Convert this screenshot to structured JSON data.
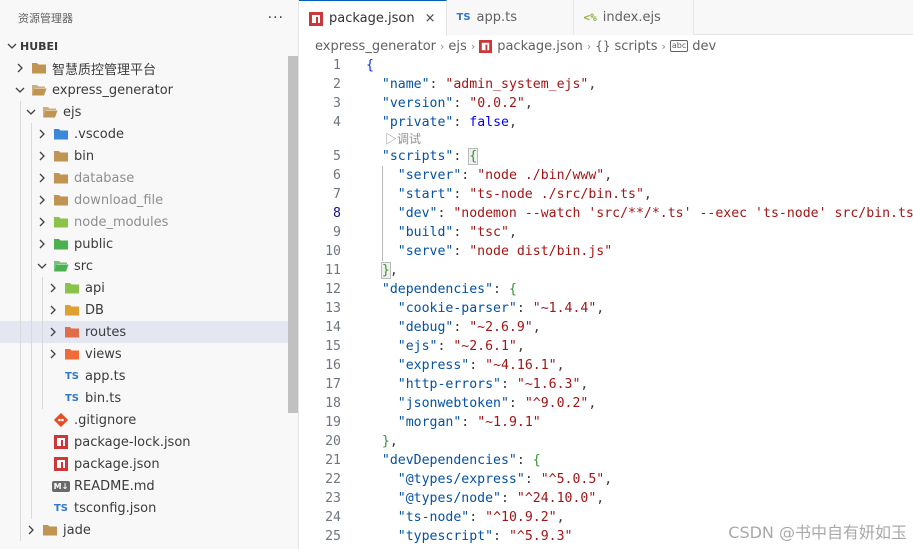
{
  "sidebar": {
    "title": "资源管理器",
    "more": "···",
    "section": "HUBEI",
    "items": [
      {
        "label": "智慧质控管理平台",
        "depth": 1,
        "kind": "folder",
        "open": false,
        "color": "#c09553"
      },
      {
        "label": "express_generator",
        "depth": 1,
        "kind": "folder",
        "open": true,
        "color": "#c09553"
      },
      {
        "label": "ejs",
        "depth": 2,
        "kind": "folder",
        "open": true,
        "color": "#c09553"
      },
      {
        "label": ".vscode",
        "depth": 3,
        "kind": "folder",
        "open": false,
        "color": "#3b88d8"
      },
      {
        "label": "bin",
        "depth": 3,
        "kind": "folder",
        "open": false,
        "color": "#c09553"
      },
      {
        "label": "database",
        "depth": 3,
        "kind": "folder",
        "open": false,
        "color": "#c09553",
        "dim": true
      },
      {
        "label": "download_file",
        "depth": 3,
        "kind": "folder",
        "open": false,
        "color": "#c09553",
        "dim": true
      },
      {
        "label": "node_modules",
        "depth": 3,
        "kind": "folder",
        "open": false,
        "color": "#8bc34a",
        "dim": true
      },
      {
        "label": "public",
        "depth": 3,
        "kind": "folder",
        "open": false,
        "color": "#4caf50"
      },
      {
        "label": "src",
        "depth": 3,
        "kind": "folder",
        "open": true,
        "color": "#4caf50"
      },
      {
        "label": "api",
        "depth": 4,
        "kind": "folder",
        "open": false,
        "color": "#8bc34a"
      },
      {
        "label": "DB",
        "depth": 4,
        "kind": "folder",
        "open": false,
        "color": "#e0a030"
      },
      {
        "label": "routes",
        "depth": 4,
        "kind": "folder",
        "open": false,
        "color": "#e06c4a",
        "selected": true
      },
      {
        "label": "views",
        "depth": 4,
        "kind": "folder",
        "open": false,
        "color": "#ef6c3a"
      },
      {
        "label": "app.ts",
        "depth": 4,
        "kind": "ts"
      },
      {
        "label": "bin.ts",
        "depth": 4,
        "kind": "ts"
      },
      {
        "label": ".gitignore",
        "depth": 3,
        "kind": "git"
      },
      {
        "label": "package-lock.json",
        "depth": 3,
        "kind": "npm"
      },
      {
        "label": "package.json",
        "depth": 3,
        "kind": "npm"
      },
      {
        "label": "README.md",
        "depth": 3,
        "kind": "md"
      },
      {
        "label": "tsconfig.json",
        "depth": 3,
        "kind": "tsconfig"
      },
      {
        "label": "jade",
        "depth": 2,
        "kind": "folder",
        "open": false,
        "color": "#c09553"
      }
    ]
  },
  "tabs": [
    {
      "label": "package.json",
      "icon": "npm-icon",
      "active": true,
      "close": "×"
    },
    {
      "label": "app.ts",
      "icon": "typescript-icon",
      "active": false
    },
    {
      "label": "index.ejs",
      "icon": "ejs-icon",
      "active": false
    }
  ],
  "breadcrumb": {
    "items": [
      "express_generator",
      "ejs",
      "package.json",
      "scripts",
      "dev"
    ],
    "scripts_prefix": "{}",
    "dev_prefix": "abc"
  },
  "code_lens": "▷调试",
  "code": [
    {
      "n": "1",
      "tokens": [
        [
          "brk1",
          "{"
        ]
      ]
    },
    {
      "n": "2",
      "tokens": [
        [
          "p",
          "  "
        ],
        [
          "k",
          "\"name\""
        ],
        [
          "p",
          ": "
        ],
        [
          "s",
          "\"admin_system_ejs\""
        ],
        [
          "p",
          ","
        ]
      ]
    },
    {
      "n": "3",
      "tokens": [
        [
          "p",
          "  "
        ],
        [
          "k",
          "\"version\""
        ],
        [
          "p",
          ": "
        ],
        [
          "s",
          "\"0.0.2\""
        ],
        [
          "p",
          ","
        ]
      ]
    },
    {
      "n": "4",
      "tokens": [
        [
          "p",
          "  "
        ],
        [
          "k",
          "\"private\""
        ],
        [
          "p",
          ": "
        ],
        [
          "b",
          "false"
        ],
        [
          "p",
          ","
        ]
      ]
    },
    {
      "n": "5",
      "tokens": [
        [
          "p",
          "  "
        ],
        [
          "k",
          "\"scripts\""
        ],
        [
          "p",
          ": "
        ],
        [
          "brk2 bmatch",
          "{"
        ]
      ],
      "lens_before": true
    },
    {
      "n": "6",
      "tokens": [
        [
          "p",
          "    "
        ],
        [
          "k",
          "\"server\""
        ],
        [
          "p",
          ": "
        ],
        [
          "s",
          "\"node ./bin/www\""
        ],
        [
          "p",
          ","
        ]
      ]
    },
    {
      "n": "7",
      "tokens": [
        [
          "p",
          "    "
        ],
        [
          "k",
          "\"start\""
        ],
        [
          "p",
          ": "
        ],
        [
          "s",
          "\"ts-node ./src/bin.ts\""
        ],
        [
          "p",
          ","
        ]
      ]
    },
    {
      "n": "8",
      "tokens": [
        [
          "p",
          "    "
        ],
        [
          "k",
          "\"dev\""
        ],
        [
          "p",
          ": "
        ],
        [
          "s",
          "\"nodemon --watch 'src/**/*.ts' --exec 'ts-node' src/bin.ts\""
        ],
        [
          "p",
          ","
        ]
      ],
      "current": true
    },
    {
      "n": "9",
      "tokens": [
        [
          "p",
          "    "
        ],
        [
          "k",
          "\"build\""
        ],
        [
          "p",
          ": "
        ],
        [
          "s",
          "\"tsc\""
        ],
        [
          "p",
          ","
        ]
      ]
    },
    {
      "n": "10",
      "tokens": [
        [
          "p",
          "    "
        ],
        [
          "k",
          "\"serve\""
        ],
        [
          "p",
          ": "
        ],
        [
          "s",
          "\"node dist/bin.js\""
        ]
      ]
    },
    {
      "n": "11",
      "tokens": [
        [
          "p",
          "  "
        ],
        [
          "brk2 bmatch",
          "}"
        ],
        [
          "p",
          ","
        ]
      ]
    },
    {
      "n": "12",
      "tokens": [
        [
          "p",
          "  "
        ],
        [
          "k",
          "\"dependencies\""
        ],
        [
          "p",
          ": "
        ],
        [
          "brk2",
          "{"
        ]
      ]
    },
    {
      "n": "13",
      "tokens": [
        [
          "p",
          "    "
        ],
        [
          "k",
          "\"cookie-parser\""
        ],
        [
          "p",
          ": "
        ],
        [
          "s",
          "\"~1.4.4\""
        ],
        [
          "p",
          ","
        ]
      ]
    },
    {
      "n": "14",
      "tokens": [
        [
          "p",
          "    "
        ],
        [
          "k",
          "\"debug\""
        ],
        [
          "p",
          ": "
        ],
        [
          "s",
          "\"~2.6.9\""
        ],
        [
          "p",
          ","
        ]
      ]
    },
    {
      "n": "15",
      "tokens": [
        [
          "p",
          "    "
        ],
        [
          "k",
          "\"ejs\""
        ],
        [
          "p",
          ": "
        ],
        [
          "s",
          "\"~2.6.1\""
        ],
        [
          "p",
          ","
        ]
      ]
    },
    {
      "n": "16",
      "tokens": [
        [
          "p",
          "    "
        ],
        [
          "k",
          "\"express\""
        ],
        [
          "p",
          ": "
        ],
        [
          "s",
          "\"~4.16.1\""
        ],
        [
          "p",
          ","
        ]
      ]
    },
    {
      "n": "17",
      "tokens": [
        [
          "p",
          "    "
        ],
        [
          "k",
          "\"http-errors\""
        ],
        [
          "p",
          ": "
        ],
        [
          "s",
          "\"~1.6.3\""
        ],
        [
          "p",
          ","
        ]
      ]
    },
    {
      "n": "18",
      "tokens": [
        [
          "p",
          "    "
        ],
        [
          "k",
          "\"jsonwebtoken\""
        ],
        [
          "p",
          ": "
        ],
        [
          "s",
          "\"^9.0.2\""
        ],
        [
          "p",
          ","
        ]
      ]
    },
    {
      "n": "19",
      "tokens": [
        [
          "p",
          "    "
        ],
        [
          "k",
          "\"morgan\""
        ],
        [
          "p",
          ": "
        ],
        [
          "s",
          "\"~1.9.1\""
        ]
      ]
    },
    {
      "n": "20",
      "tokens": [
        [
          "p",
          "  "
        ],
        [
          "brk2",
          "}"
        ],
        [
          "p",
          ","
        ]
      ]
    },
    {
      "n": "21",
      "tokens": [
        [
          "p",
          "  "
        ],
        [
          "k",
          "\"devDependencies\""
        ],
        [
          "p",
          ": "
        ],
        [
          "brk2",
          "{"
        ]
      ]
    },
    {
      "n": "22",
      "tokens": [
        [
          "p",
          "    "
        ],
        [
          "k",
          "\"@types/express\""
        ],
        [
          "p",
          ": "
        ],
        [
          "s",
          "\"^5.0.5\""
        ],
        [
          "p",
          ","
        ]
      ]
    },
    {
      "n": "23",
      "tokens": [
        [
          "p",
          "    "
        ],
        [
          "k",
          "\"@types/node\""
        ],
        [
          "p",
          ": "
        ],
        [
          "s",
          "\"^24.10.0\""
        ],
        [
          "p",
          ","
        ]
      ]
    },
    {
      "n": "24",
      "tokens": [
        [
          "p",
          "    "
        ],
        [
          "k",
          "\"ts-node\""
        ],
        [
          "p",
          ": "
        ],
        [
          "s",
          "\"^10.9.2\""
        ],
        [
          "p",
          ","
        ]
      ]
    },
    {
      "n": "25",
      "tokens": [
        [
          "p",
          "    "
        ],
        [
          "k",
          "\"typescript\""
        ],
        [
          "p",
          ": "
        ],
        [
          "s",
          "\"^5.9.3\""
        ]
      ]
    }
  ],
  "watermark": "CSDN @书中自有妍如玉",
  "colors": {
    "accent": "#005fb8",
    "string": "#a31515",
    "key": "#0451a5",
    "keyword": "#0000ff",
    "selection": "#e4e6f1"
  }
}
